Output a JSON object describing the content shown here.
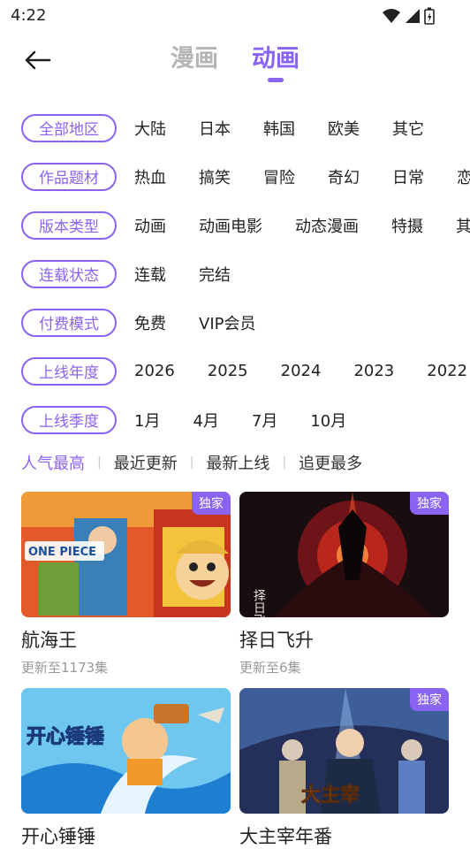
{
  "status": {
    "time": "4:22"
  },
  "tabs": [
    {
      "label": "漫画",
      "active": false
    },
    {
      "label": "动画",
      "active": true
    }
  ],
  "filters": [
    {
      "label": "全部地区",
      "options": [
        "大陆",
        "日本",
        "韩国",
        "欧美",
        "其它"
      ]
    },
    {
      "label": "作品题材",
      "options": [
        "热血",
        "搞笑",
        "冒险",
        "奇幻",
        "日常",
        "恋"
      ]
    },
    {
      "label": "版本类型",
      "options": [
        "动画",
        "动画电影",
        "动态漫画",
        "特摄",
        "其"
      ]
    },
    {
      "label": "连载状态",
      "options": [
        "连载",
        "完结"
      ]
    },
    {
      "label": "付费模式",
      "options": [
        "免费",
        "VIP会员"
      ]
    },
    {
      "label": "上线年度",
      "options": [
        "2026",
        "2025",
        "2024",
        "2023",
        "2022"
      ]
    },
    {
      "label": "上线季度",
      "options": [
        "1月",
        "4月",
        "7月",
        "10月"
      ]
    }
  ],
  "sort": {
    "items": [
      "人气最高",
      "最近更新",
      "最新上线",
      "追更最多"
    ],
    "active_index": 0
  },
  "cards": [
    {
      "title": "航海王",
      "subtitle": "更新至1173集",
      "badge": "独家",
      "art_text": "ONE PIECE"
    },
    {
      "title": "择日飞升",
      "subtitle": "更新至6集",
      "badge": "独家",
      "art_text": "择日飞升"
    },
    {
      "title": "开心锤锤",
      "subtitle": "",
      "badge": "",
      "art_text": "开心锤锤"
    },
    {
      "title": "大主宰年番",
      "subtitle": "",
      "badge": "独家",
      "art_text": "大主宰"
    }
  ],
  "colors": {
    "accent": "#8a63f2",
    "badge_bg": "#8a63f2"
  }
}
